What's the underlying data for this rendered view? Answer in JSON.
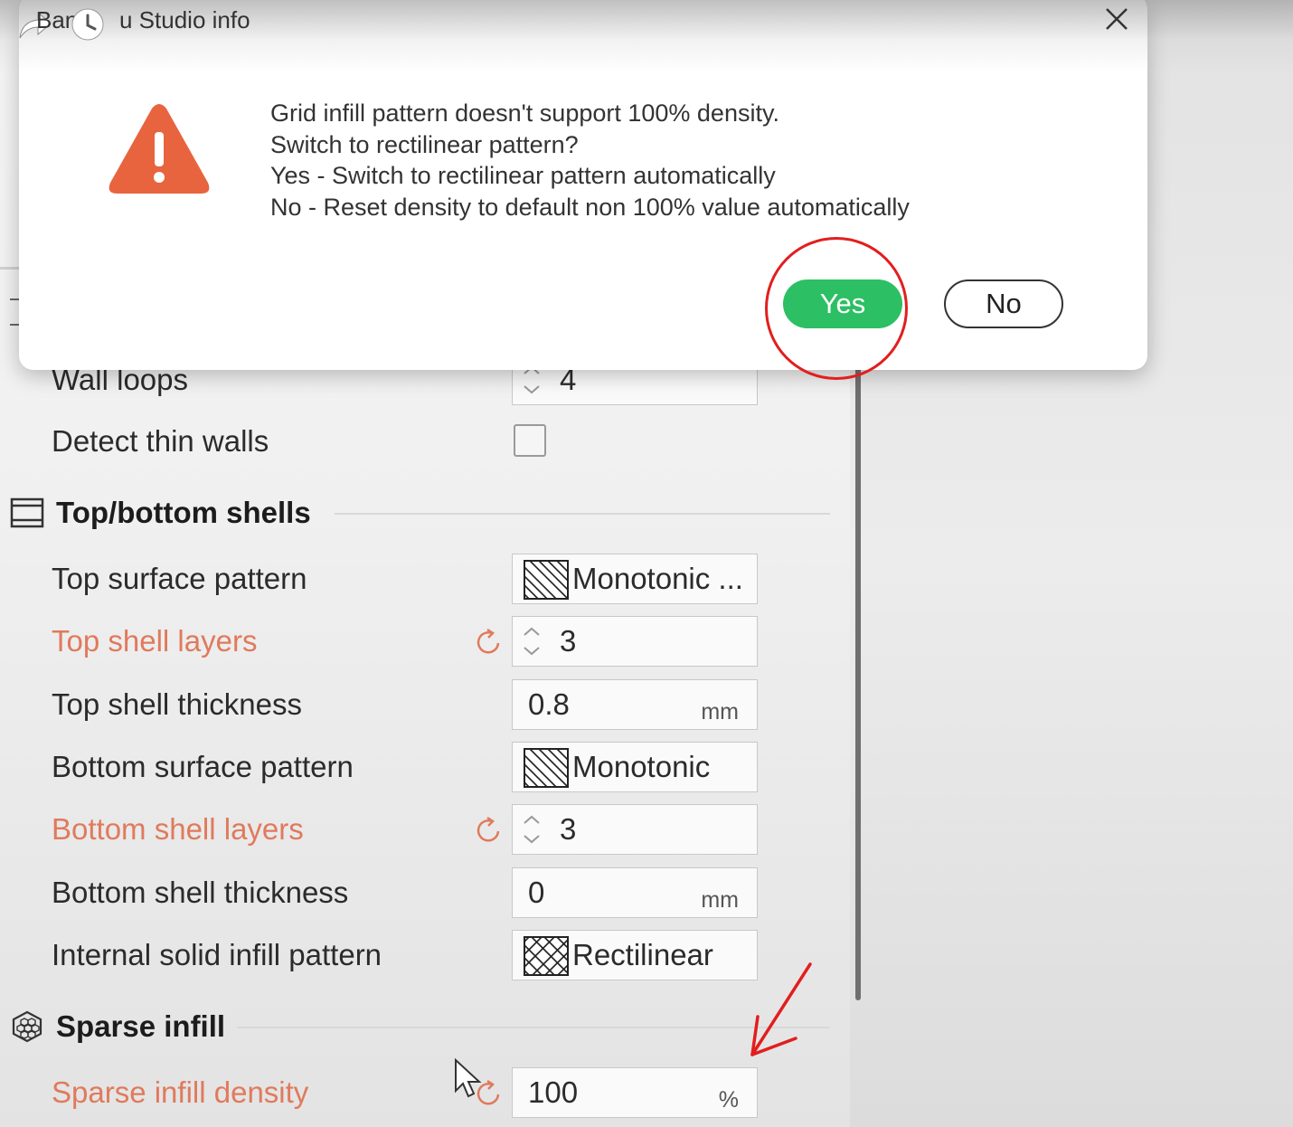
{
  "dialog": {
    "title_prefix": "Ban",
    "title": "u Studio info",
    "messages": [
      "Grid infill pattern doesn't support 100% density.",
      "Switch to rectilinear pattern?",
      "Yes - Switch to rectilinear pattern automatically",
      "No - Reset density to default non 100% value automatically"
    ],
    "yes_label": "Yes",
    "no_label": "No",
    "yes_color": "#2dbf63",
    "warning_color": "#e8643e"
  },
  "settings": {
    "walls": {
      "wall_loops": {
        "label": "Wall loops",
        "value": "4"
      },
      "detect_thin_walls": {
        "label": "Detect thin walls",
        "checked": false
      }
    },
    "top_bottom": {
      "title": "Top/bottom shells",
      "top_surface_pattern": {
        "label": "Top surface pattern",
        "value": "Monotonic ..."
      },
      "top_shell_layers": {
        "label": "Top shell layers",
        "value": "3"
      },
      "top_shell_thickness": {
        "label": "Top shell thickness",
        "value": "0.8",
        "unit": "mm"
      },
      "bottom_surface_pattern": {
        "label": "Bottom surface pattern",
        "value": "Monotonic"
      },
      "bottom_shell_layers": {
        "label": "Bottom shell layers",
        "value": "3"
      },
      "bottom_shell_thickness": {
        "label": "Bottom shell thickness",
        "value": "0",
        "unit": "mm"
      },
      "internal_solid_infill_pattern": {
        "label": "Internal solid infill pattern",
        "value": "Rectilinear"
      }
    },
    "sparse": {
      "title": "Sparse infill",
      "sparse_infill_density": {
        "label": "Sparse infill density",
        "value": "100",
        "unit": "%"
      }
    },
    "modified_color": "#e07a5c"
  },
  "annotations": {
    "color": "#e21e1e"
  }
}
